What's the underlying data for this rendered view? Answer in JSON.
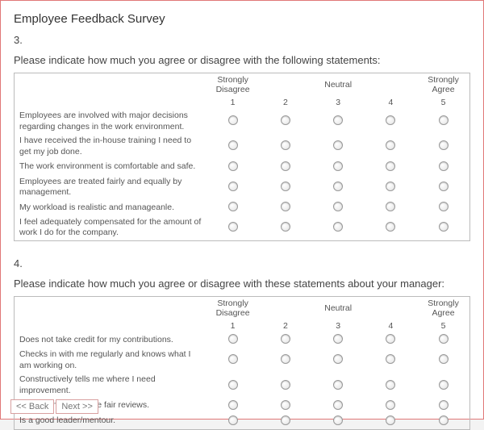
{
  "title": "Employee Feedback Survey",
  "scale": {
    "low_label": "Strongly Disagree",
    "mid_label": "Neutral",
    "high_label": "Strongly Agree",
    "n1": "1",
    "n2": "2",
    "n3": "3",
    "n4": "4",
    "n5": "5"
  },
  "q3": {
    "number": "3.",
    "prompt": "Please indicate how much you agree or disagree with the following statements:",
    "statements": {
      "s0": "Employees are involved with major decisions regarding changes in the work environment.",
      "s1": "I have received the in-house training I need to get my job done.",
      "s2": "The work environment is comfortable and safe.",
      "s3": "Employees are treated fairly and equally by management.",
      "s4": "My workload is realistic and manageanle.",
      "s5": "I feel adequately compensated for the amount of work I do for the company."
    }
  },
  "q4": {
    "number": "4.",
    "prompt": "Please indicate how much you agree or disagree with these statements about your manager:",
    "statements": {
      "s0": "Does not take credit for my contributions.",
      "s1": "Checks in with me regularly and knows what I am working on.",
      "s2": "Constructively tells me where I need improvement.",
      "s3": "Consistently gives me fair reviews.",
      "s4": "Is a good leader/mentour."
    }
  },
  "nav": {
    "back": "<< Back",
    "next": "Next >>"
  }
}
